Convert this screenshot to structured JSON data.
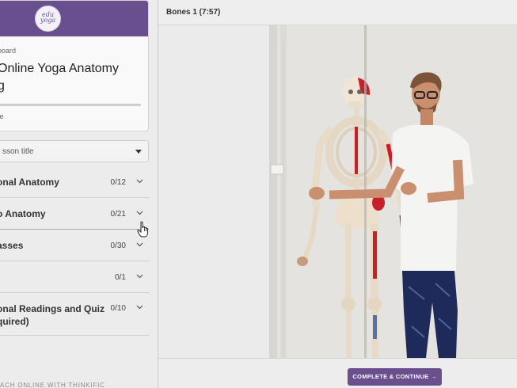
{
  "sidebar": {
    "logo_text": "edu\nyoga",
    "dashboard_link": "board",
    "course_title": "Online Yoga Anatomy\ng",
    "progress": {
      "label": "te",
      "fraction": 0.0
    },
    "search_placeholder": "sson title",
    "chapters": [
      {
        "title": "onal Anatomy",
        "count": "0/12"
      },
      {
        "title": "o Anatomy",
        "count": "0/21"
      },
      {
        "title": "asses",
        "count": "0/30"
      },
      {
        "title": "",
        "count": "0/1"
      },
      {
        "title": "onal Readings and Quiz\nquired)",
        "count": "0/10"
      }
    ],
    "powered_by": "ACH ONLINE WITH THINKIFIC"
  },
  "lesson": {
    "title": "Bones 1 (7:57)"
  },
  "footer": {
    "complete_label": "COMPLETE & CONTINUE →"
  },
  "colors": {
    "brand": "#6a4f8e",
    "sidebar_bg": "#ececec"
  },
  "icons": {
    "dropdown": "caret-down-icon",
    "chapter_toggle": "chevron-down-icon",
    "cursor": "hand-pointer-icon"
  }
}
